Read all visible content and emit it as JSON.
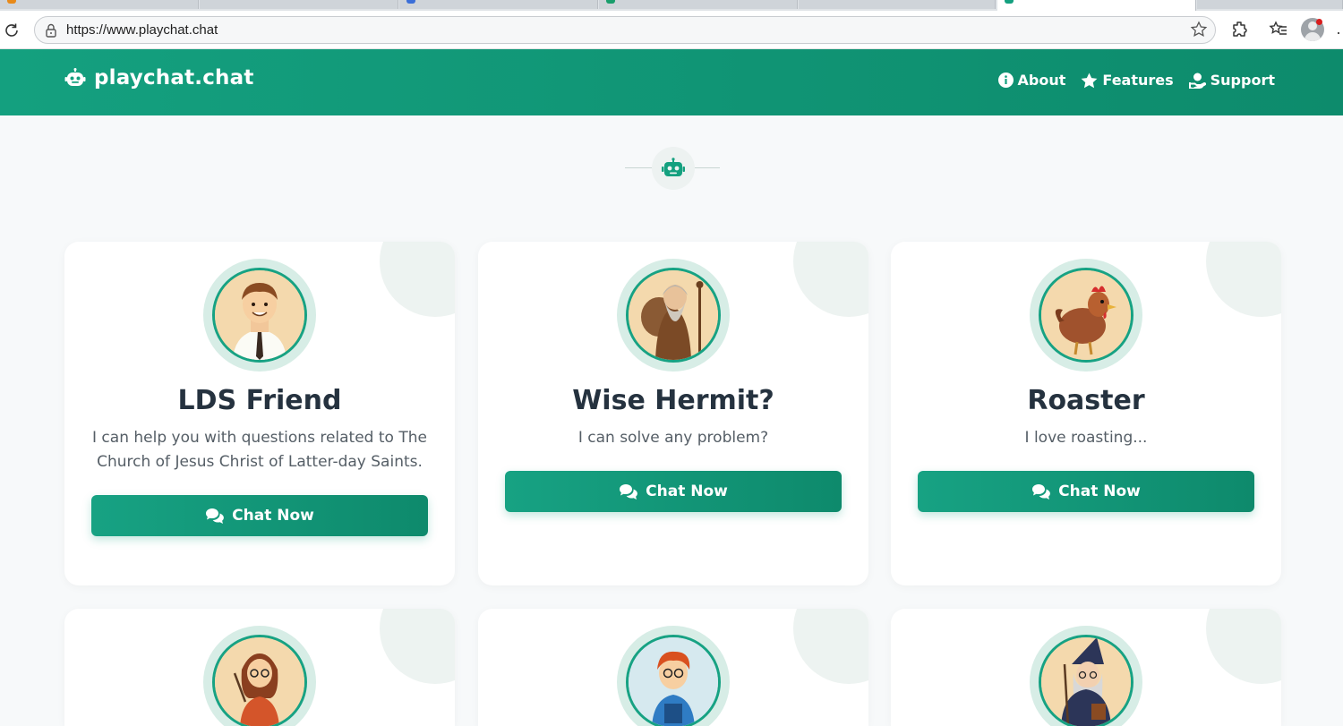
{
  "browser": {
    "url": "https://www.playchat.chat",
    "icons": [
      "reload-icon",
      "lock-icon",
      "star-icon",
      "extensions-icon",
      "favorites-icon",
      "profile-icon",
      "more-icon"
    ]
  },
  "header": {
    "brand": "playchat.chat",
    "nav": [
      {
        "label": "About",
        "icon": "info-icon"
      },
      {
        "label": "Features",
        "icon": "star-icon"
      },
      {
        "label": "Support",
        "icon": "support-icon"
      }
    ]
  },
  "colors": {
    "brand_green": "#14a07f",
    "brand_green_dark": "#0d8b6c",
    "page_bg": "#f7f9fa",
    "title_text": "#25323f"
  },
  "characters": [
    {
      "name": "LDS Friend",
      "description": "I can help you with questions related to The Church of Jesus Christ of Latter-day Saints.",
      "button": "Chat Now"
    },
    {
      "name": "Wise Hermit?",
      "description": "I can solve any problem?",
      "button": "Chat Now"
    },
    {
      "name": "Roaster",
      "description": "I love roasting...",
      "button": "Chat Now"
    },
    {
      "name": "",
      "description": "",
      "button": ""
    },
    {
      "name": "",
      "description": "",
      "button": ""
    },
    {
      "name": "",
      "description": "",
      "button": ""
    }
  ]
}
